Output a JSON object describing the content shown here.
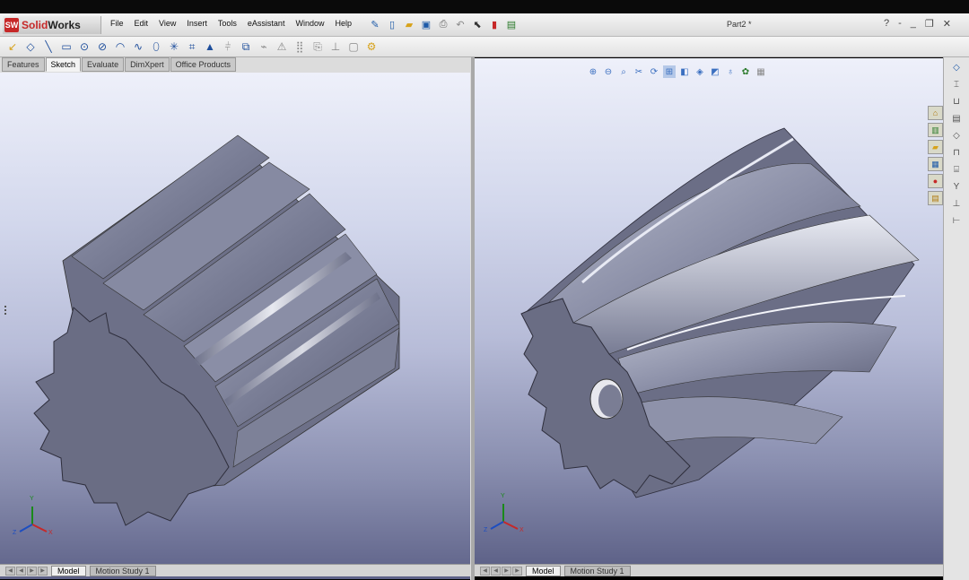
{
  "app": {
    "logo_mark": "SW",
    "logo_text_a": "Solid",
    "logo_text_b": "Works",
    "doc_title": "Part2 *"
  },
  "menu": [
    "File",
    "Edit",
    "View",
    "Insert",
    "Tools",
    "eAssistant",
    "Window",
    "Help"
  ],
  "window_controls": [
    "?",
    "-",
    "_",
    "❐",
    "✕"
  ],
  "command_tabs": [
    {
      "label": "Features",
      "active": false
    },
    {
      "label": "Sketch",
      "active": true
    },
    {
      "label": "Evaluate",
      "active": false
    },
    {
      "label": "DimXpert",
      "active": false
    },
    {
      "label": "Office Products",
      "active": false
    }
  ],
  "bottom_tabs": [
    {
      "label": "Model",
      "active": true
    },
    {
      "label": "Motion Study 1",
      "active": false
    }
  ],
  "triad": {
    "x": "X",
    "y": "Y",
    "z": "Z"
  },
  "accent": "#c62828",
  "icons": {
    "titlebar": [
      "pin-icon",
      "new-document-icon",
      "open-icon",
      "save-icon",
      "print-icon",
      "undo-icon",
      "select-icon",
      "rebuild-icon",
      "options-icon"
    ],
    "sketch": [
      "smart-dimension-icon",
      "line-icon",
      "rectangle-icon",
      "circle-icon",
      "arc-icon",
      "spline-icon",
      "ellipse-icon",
      "point-icon",
      "trim-icon",
      "mirror-icon",
      "offset-icon",
      "pattern-icon"
    ],
    "view": [
      "zoom-fit-icon",
      "zoom-area-icon",
      "previous-view-icon",
      "section-view-icon",
      "rotate-icon",
      "view-orientation-icon",
      "display-style-icon",
      "hide-show-icon",
      "appearance-icon",
      "scene-icon"
    ],
    "taskpane": [
      "home-icon",
      "library-icon",
      "explorer-icon",
      "palette-icon",
      "appearance-icon",
      "custom-properties-icon"
    ]
  }
}
